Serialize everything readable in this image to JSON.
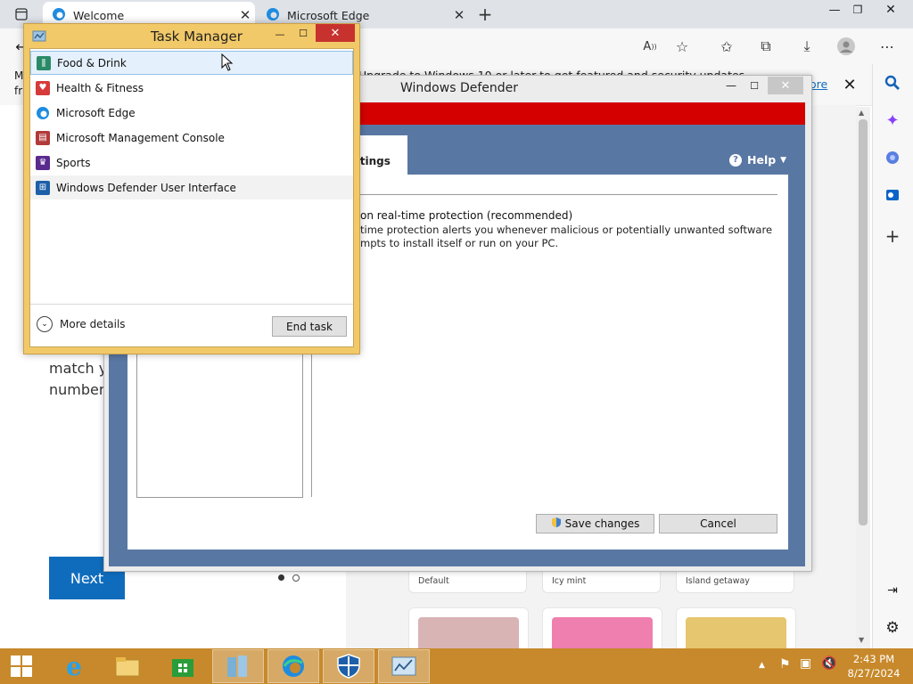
{
  "browser": {
    "tabs": [
      {
        "label": "Welcome",
        "active": true
      },
      {
        "label": "Microsoft Edge",
        "active": false
      }
    ],
    "info_text_1": "Upgrade to Windows 10 or later to get featured and security updates",
    "info_text_left": "M",
    "info_text_left2": "fr",
    "info_link": "ore",
    "page": {
      "text_line1": "match yo",
      "text_line2": "number",
      "next_label": "Next",
      "themes": [
        "Default",
        "Icy mint",
        "Island getaway"
      ],
      "colors": {
        "folder1": "#d9b4b4",
        "folder2": "#ef7fae",
        "folder3": "#e6c66e"
      }
    }
  },
  "defender": {
    "title": "Windows Defender",
    "tab_label": "ttings",
    "help_label": "Help",
    "rt_heading": "on real-time protection (recommended)",
    "rt_desc1": "time protection alerts you whenever malicious or potentially unwanted software",
    "rt_desc2": "mpts to install itself or run on your PC.",
    "save_label": "Save changes",
    "cancel_label": "Cancel",
    "colors": {
      "band": "#d40000",
      "frame": "#5977a3"
    }
  },
  "task_manager": {
    "title": "Task Manager",
    "apps": [
      {
        "label": "Food & Drink",
        "icon": "food-icon",
        "color": "#2a8a68"
      },
      {
        "label": "Health & Fitness",
        "icon": "health-icon",
        "color": "#d63b3b"
      },
      {
        "label": "Microsoft Edge",
        "icon": "edge-icon",
        "color": "#0b78d4"
      },
      {
        "label": "Microsoft Management Console",
        "icon": "mmc-icon",
        "color": "#b23a3a"
      },
      {
        "label": "Sports",
        "icon": "sports-icon",
        "color": "#5a2a8f"
      },
      {
        "label": "Windows Defender User Interface",
        "icon": "defender-icon",
        "color": "#1d5fa8"
      }
    ],
    "more_details_label": "More details",
    "end_task_label": "End task"
  },
  "taskbar": {
    "time": "2:43 PM",
    "date": "8/27/2024",
    "color": "#c7892b"
  }
}
